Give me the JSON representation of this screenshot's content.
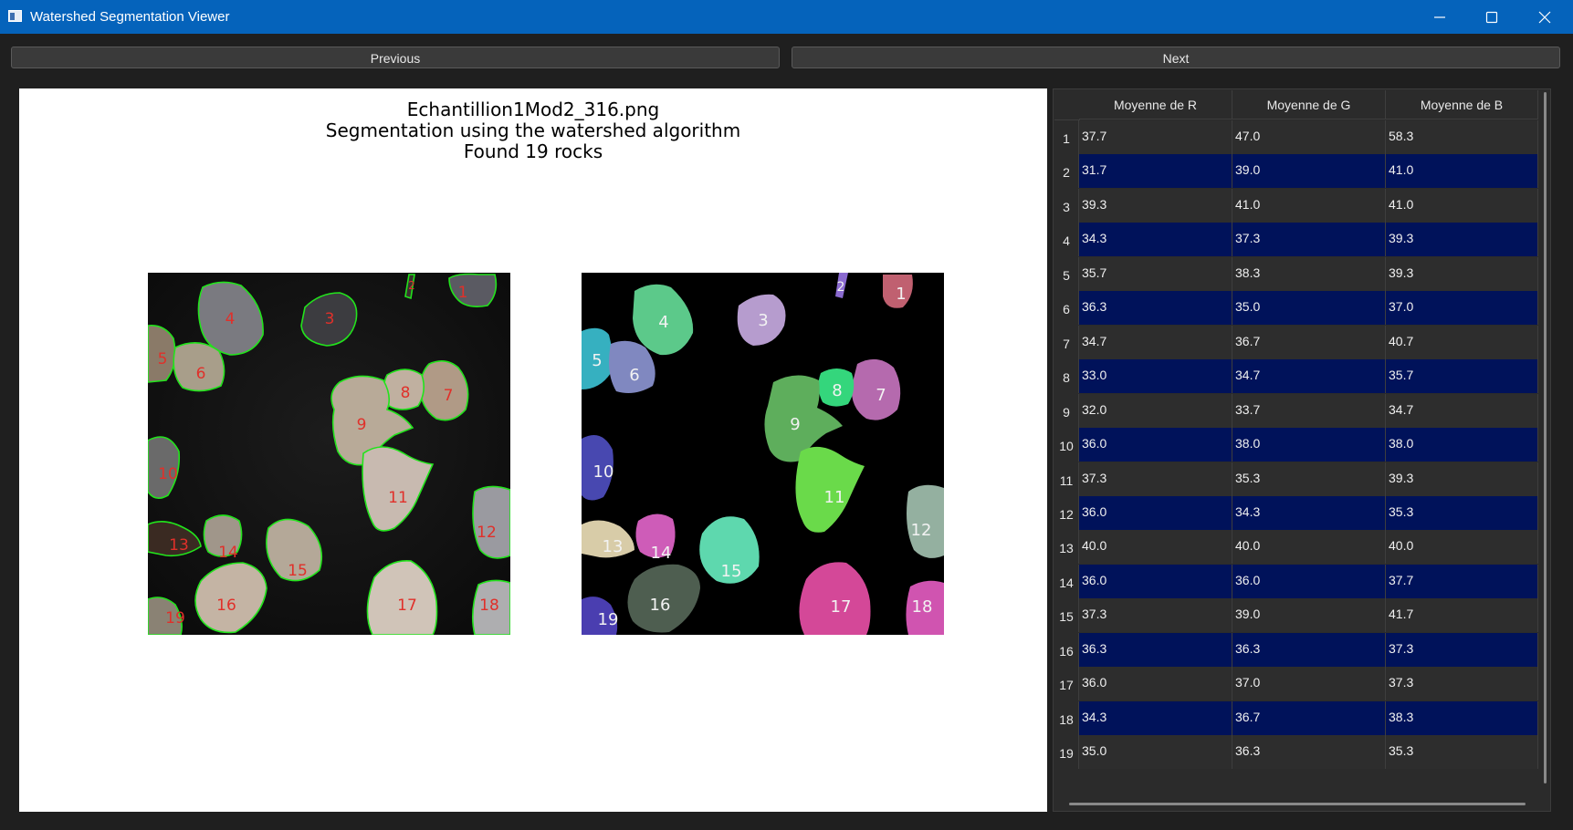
{
  "window": {
    "title": "Watershed Segmentation Viewer"
  },
  "toolbar": {
    "previous_label": "Previous",
    "next_label": "Next"
  },
  "figure": {
    "title_lines": [
      "Echantillion1Mod2_316.png",
      "Segmentation using the watershed algorithm",
      "Found 19 rocks"
    ],
    "left_panel_labels": [
      "1",
      "2",
      "3",
      "4",
      "5",
      "6",
      "7",
      "8",
      "9",
      "10",
      "11",
      "12",
      "13",
      "14",
      "15",
      "16",
      "17",
      "18",
      "19"
    ],
    "right_panel_labels": [
      "1",
      "2",
      "3",
      "4",
      "5",
      "6",
      "7",
      "8",
      "9",
      "10",
      "11",
      "12",
      "13",
      "14",
      "15",
      "16",
      "17",
      "18",
      "19"
    ]
  },
  "table": {
    "columns": [
      "Moyenne de R",
      "Moyenne de G",
      "Moyenne de B"
    ],
    "rows": [
      {
        "id": "1",
        "r": "37.7",
        "g": "47.0",
        "b": "58.3"
      },
      {
        "id": "2",
        "r": "31.7",
        "g": "39.0",
        "b": "41.0"
      },
      {
        "id": "3",
        "r": "39.3",
        "g": "41.0",
        "b": "41.0"
      },
      {
        "id": "4",
        "r": "34.3",
        "g": "37.3",
        "b": "39.3"
      },
      {
        "id": "5",
        "r": "35.7",
        "g": "38.3",
        "b": "39.3"
      },
      {
        "id": "6",
        "r": "36.3",
        "g": "35.0",
        "b": "37.0"
      },
      {
        "id": "7",
        "r": "34.7",
        "g": "36.7",
        "b": "40.7"
      },
      {
        "id": "8",
        "r": "33.0",
        "g": "34.7",
        "b": "35.7"
      },
      {
        "id": "9",
        "r": "32.0",
        "g": "33.7",
        "b": "34.7"
      },
      {
        "id": "10",
        "r": "36.0",
        "g": "38.0",
        "b": "38.0"
      },
      {
        "id": "11",
        "r": "37.3",
        "g": "35.3",
        "b": "39.3"
      },
      {
        "id": "12",
        "r": "36.0",
        "g": "34.3",
        "b": "35.3"
      },
      {
        "id": "13",
        "r": "40.0",
        "g": "40.0",
        "b": "40.0"
      },
      {
        "id": "14",
        "r": "36.0",
        "g": "36.0",
        "b": "37.7"
      },
      {
        "id": "15",
        "r": "37.3",
        "g": "39.0",
        "b": "41.7"
      },
      {
        "id": "16",
        "r": "36.3",
        "g": "36.3",
        "b": "37.3"
      },
      {
        "id": "17",
        "r": "36.0",
        "g": "37.0",
        "b": "37.3"
      },
      {
        "id": "18",
        "r": "34.3",
        "g": "36.7",
        "b": "38.3"
      },
      {
        "id": "19",
        "r": "35.0",
        "g": "36.3",
        "b": "35.3"
      }
    ]
  },
  "colors": {
    "titlebar": "#0563bb",
    "contour": "#22e31c",
    "label_red": "#e0302a",
    "selected_row": "#00125a"
  }
}
